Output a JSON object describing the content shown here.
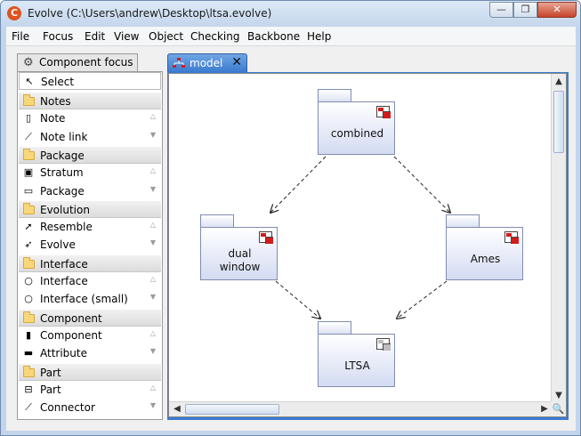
{
  "window": {
    "title": "Evolve (C:\\Users\\andrew\\Desktop\\ltsa.evolve)",
    "app_icon": "C",
    "controls": {
      "minimize": "—",
      "maximize": "❐",
      "close": "✕"
    }
  },
  "menubar": [
    "File",
    "Focus",
    "Edit",
    "View",
    "Object",
    "Checking",
    "Backbone",
    "Help"
  ],
  "palette": {
    "tab_label": "Component focus",
    "items": [
      {
        "kind": "tool",
        "label": "Select",
        "icon": "arrow-cursor-icon"
      },
      {
        "kind": "drawer",
        "label": "Notes",
        "icon": "folder-icon"
      },
      {
        "kind": "tool",
        "label": "Note",
        "icon": "note-icon"
      },
      {
        "kind": "tool",
        "label": "Note link",
        "icon": "note-link-icon"
      },
      {
        "kind": "drawer",
        "label": "Package",
        "icon": "folder-icon"
      },
      {
        "kind": "tool",
        "label": "Stratum",
        "icon": "stratum-icon"
      },
      {
        "kind": "tool",
        "label": "Package",
        "icon": "package-icon"
      },
      {
        "kind": "drawer",
        "label": "Evolution",
        "icon": "folder-icon"
      },
      {
        "kind": "tool",
        "label": "Resemble",
        "icon": "resemble-arrow-icon"
      },
      {
        "kind": "tool",
        "label": "Evolve",
        "icon": "evolve-arrow-icon"
      },
      {
        "kind": "drawer",
        "label": "Interface",
        "icon": "folder-icon"
      },
      {
        "kind": "tool",
        "label": "Interface",
        "icon": "interface-circle-icon"
      },
      {
        "kind": "tool",
        "label": "Interface (small)",
        "icon": "interface-small-icon"
      },
      {
        "kind": "drawer",
        "label": "Component",
        "icon": "folder-icon"
      },
      {
        "kind": "tool",
        "label": "Component",
        "icon": "component-icon"
      },
      {
        "kind": "tool",
        "label": "Attribute",
        "icon": "attribute-icon"
      },
      {
        "kind": "drawer",
        "label": "Part",
        "icon": "folder-icon"
      },
      {
        "kind": "tool",
        "label": "Part",
        "icon": "part-icon"
      },
      {
        "kind": "tool",
        "label": "Connector",
        "icon": "connector-icon"
      }
    ]
  },
  "editor": {
    "tab_label": "model",
    "tab_close": "✕",
    "diagram": {
      "packages": [
        {
          "id": "combined",
          "label": "combined",
          "badge": "red"
        },
        {
          "id": "dual",
          "label": "dual\nwindow",
          "badge": "red"
        },
        {
          "id": "ames",
          "label": "Ames",
          "badge": "red"
        },
        {
          "id": "ltsa",
          "label": "LTSA",
          "badge": "grey"
        }
      ],
      "dependencies": [
        {
          "from": "combined",
          "to": "dual",
          "style": "dashed-arrow"
        },
        {
          "from": "combined",
          "to": "ames",
          "style": "dashed-arrow"
        },
        {
          "from": "dual",
          "to": "ltsa",
          "style": "dashed-arrow"
        },
        {
          "from": "ames",
          "to": "ltsa",
          "style": "dashed-arrow"
        }
      ]
    },
    "scroll": {
      "up": "▲",
      "down": "▼",
      "left": "◀",
      "right": "▶",
      "zoom": "🔍"
    }
  },
  "colors": {
    "selected_tab": "#3b7bd0",
    "badge_red": "#d21c1c",
    "package_border": "#7f8db0"
  }
}
